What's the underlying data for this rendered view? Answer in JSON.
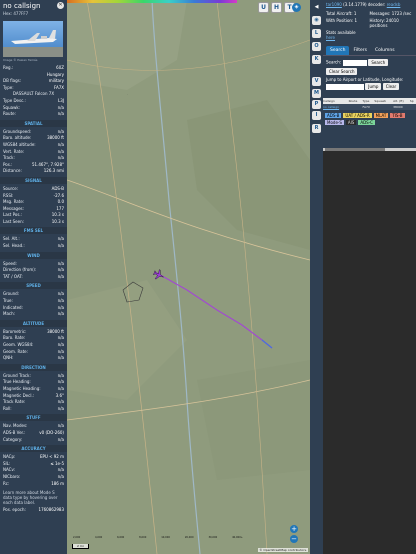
{
  "aircraft": {
    "callsign": "no callsign",
    "hex": "Hex:  477FF7",
    "photo_credit": "Image © Pasian Tamás",
    "reg_rows": [
      {
        "k": "Reg.:",
        "v": "60Z"
      },
      {
        "k": "",
        "v": "Hungary"
      },
      {
        "k": "DB flags:",
        "v": "military"
      },
      {
        "k": "Type:",
        "v": "FA7X"
      }
    ],
    "type_name": "DASSAULT Falcon 7X",
    "desc_rows": [
      {
        "k": "Type Desc.:",
        "v": "L3J"
      },
      {
        "k": "Squawk:",
        "v": "n/a"
      },
      {
        "k": "Route:",
        "v": "n/a"
      }
    ]
  },
  "sections": [
    {
      "title": "SPATIAL",
      "rows": [
        {
          "k": "Groundspeed:",
          "v": "n/a"
        },
        {
          "k": "Baro. altitude:",
          "v": "38000 ft"
        },
        {
          "k": "WGS84 altitude:",
          "v": "n/a"
        },
        {
          "k": "Vert. Rate:",
          "v": "n/a"
        },
        {
          "k": "Track:",
          "v": "n/a"
        },
        {
          "k": "Pos.:",
          "v": "51.467°, 7.928°"
        },
        {
          "k": "Distance:",
          "v": "126.3 nmi"
        }
      ]
    },
    {
      "title": "SIGNAL",
      "rows": [
        {
          "k": "Source:",
          "v": "ADS-B"
        },
        {
          "k": "RSSI:",
          "v": "-27.6"
        },
        {
          "k": "Msg. Rate:",
          "v": "0.0"
        },
        {
          "k": "Messages:",
          "v": "177"
        },
        {
          "k": "Last Pos.:",
          "v": "10.3 s"
        },
        {
          "k": "Last Seen:",
          "v": "10.3 s"
        }
      ]
    },
    {
      "title": "FMS SEL",
      "rows": [
        {
          "k": "Sel. Alt.:",
          "v": "n/a"
        },
        {
          "k": "Sel. Head.:",
          "v": "n/a"
        }
      ]
    },
    {
      "title": "WIND",
      "rows": [
        {
          "k": "Speed:",
          "v": "n/a"
        },
        {
          "k": "Direction (from):",
          "v": "n/a"
        },
        {
          "k": "TAT / OAT:",
          "v": "n/a"
        }
      ]
    },
    {
      "title": "SPEED",
      "rows": [
        {
          "k": "Ground:",
          "v": "n/a"
        },
        {
          "k": "True:",
          "v": "n/a"
        },
        {
          "k": "Indicated:",
          "v": "n/a"
        },
        {
          "k": "Mach:",
          "v": "n/a"
        }
      ]
    },
    {
      "title": "ALTITUDE",
      "rows": [
        {
          "k": "Barometric:",
          "v": "38000 ft"
        },
        {
          "k": "Baro. Rate:",
          "v": "n/a"
        },
        {
          "k": "Geom. WGS84:",
          "v": "n/a"
        },
        {
          "k": "Geom. Rate:",
          "v": "n/a"
        },
        {
          "k": "QNH:",
          "v": "n/a"
        }
      ]
    },
    {
      "title": "DIRECTION",
      "rows": [
        {
          "k": "Ground Track:",
          "v": "n/a"
        },
        {
          "k": "True Heading:",
          "v": "n/a"
        },
        {
          "k": "Magnetic Heading:",
          "v": "n/a"
        },
        {
          "k": "Magnetic Decl.:",
          "v": "3.6°"
        },
        {
          "k": "Track Rate:",
          "v": "n/a"
        },
        {
          "k": "Roll:",
          "v": "n/a"
        }
      ]
    },
    {
      "title": "STUFF",
      "rows": [
        {
          "k": "Nav. Modes:",
          "v": "n/a"
        },
        {
          "k": "ADS-B Ver.:",
          "v": "v0 (DO-260)"
        },
        {
          "k": "Category:",
          "v": "n/a"
        }
      ]
    },
    {
      "title": "ACCURACY",
      "rows": [
        {
          "k": "NACp:",
          "v": "EPU < 92 m"
        },
        {
          "k": "SIL:",
          "v": "≤ 1e-5"
        },
        {
          "k": "NACv:",
          "v": "n/a"
        },
        {
          "k": "NICbaro:",
          "v": "n/a"
        },
        {
          "k": "Rc:",
          "v": "186 m"
        }
      ]
    }
  ],
  "learn_more": "Learn more about Mode S data type by hovering over each data label.",
  "pos_epoch": {
    "k": "Pos. epoch:",
    "v": "1760862983"
  },
  "map": {
    "scale_label": "2 mi",
    "alt_ticks": [
      "2,000",
      "4,000",
      "6,000",
      "8,000",
      "10,000",
      "20,000",
      "30,000",
      "40,000+"
    ],
    "attribution": "© OpenStreetMap contributors.",
    "top_buttons": [
      "U",
      "H",
      "T"
    ],
    "side_buttons": [
      "L",
      "K",
      "M"
    ],
    "zoom_in": "+",
    "zoom_out": "−"
  },
  "toolbar": [
    "◀",
    "◉",
    "L",
    "O",
    "K",
    "V",
    "M",
    "P",
    "I",
    "R"
  ],
  "panel": {
    "version_prefix": "tar1090",
    "version_suffix": "(3.14.1779) decoder:",
    "readsb": "readsb",
    "total_label": "Total Aircraft: 1",
    "messages_label": "Messages: 1723 /sec",
    "with_pos_label": "With Position: 1",
    "history_label": "History: 24010 positions",
    "stats_label": "Stats available",
    "stats_link": "here",
    "tabs": [
      "Search",
      "Filters",
      "Columns"
    ],
    "search_label": "Search:",
    "search_button": "Search",
    "clear_search": "Clear Search",
    "jump_label": "Jump to Airport or Latitude, Longitude:",
    "jump_button": "Jump",
    "clear_button": "Clear",
    "columns": [
      "",
      "Callsign",
      "Route",
      "Type",
      "Squawk",
      "Alt. (ft)",
      "Sp"
    ],
    "row": [
      "",
      "no callsign",
      "",
      "FA7X",
      "",
      "38000",
      ""
    ],
    "chips": [
      {
        "t": "ADS-B",
        "c": "#5fa3e6"
      },
      {
        "t": "UAT / ADS-R",
        "c": "#e9d25e"
      },
      {
        "t": "MLAT",
        "c": "#f0a05a"
      },
      {
        "t": "TIS-B",
        "c": "#e07a6e"
      },
      {
        "t": "Mode-S",
        "c": "#b7b7ea"
      },
      {
        "t": "AIS",
        "c": "#2b2b2b"
      },
      {
        "t": "ADS-C",
        "c": "#7cd49a"
      }
    ]
  }
}
